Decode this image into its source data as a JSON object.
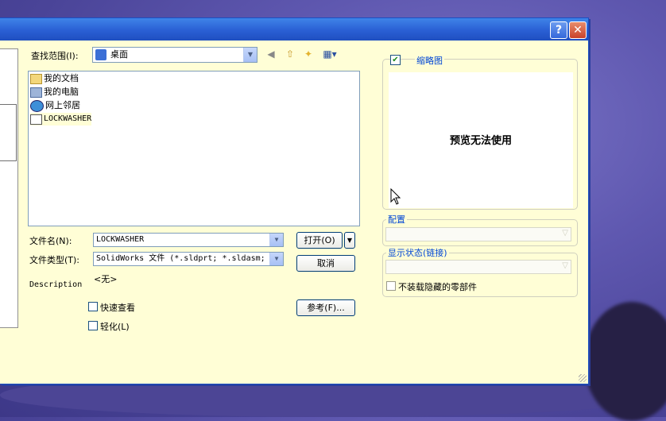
{
  "dialog": {
    "help_button": "?",
    "close_button": "✕"
  },
  "look_in": {
    "label": "查找范围(I):",
    "value": "桌面"
  },
  "toolbar": {
    "back_icon": "back-icon",
    "up_icon": "up-folder-icon",
    "new_folder_icon": "new-folder-icon",
    "views_icon": "views-menu-icon"
  },
  "files": [
    {
      "name": "我的文档",
      "icon": "my-documents-icon"
    },
    {
      "name": "我的电脑",
      "icon": "my-computer-icon"
    },
    {
      "name": "网上邻居",
      "icon": "network-icon"
    },
    {
      "name": "LOCKWASHER",
      "icon": "assembly-file-icon"
    }
  ],
  "filename": {
    "label": "文件名(N):",
    "value": "LOCKWASHER"
  },
  "filetype": {
    "label": "文件类型(T):",
    "value": "SolidWorks 文件 (*.sldprt; *.sldasm;"
  },
  "buttons": {
    "open": "打开(O)",
    "cancel": "取消",
    "reference": "参考(F)..."
  },
  "description": {
    "label": "Description",
    "value": "<无>"
  },
  "options": {
    "quick_view": "快速查看",
    "lightweight": "轻化(L)"
  },
  "thumbnail": {
    "label": "缩略图",
    "checked": true,
    "preview_text": "预览无法使用"
  },
  "configuration": {
    "label": "配置"
  },
  "display_state": {
    "label": "显示状态(链接)"
  },
  "hidden_components": {
    "label": "不装载隐藏的零部件"
  }
}
